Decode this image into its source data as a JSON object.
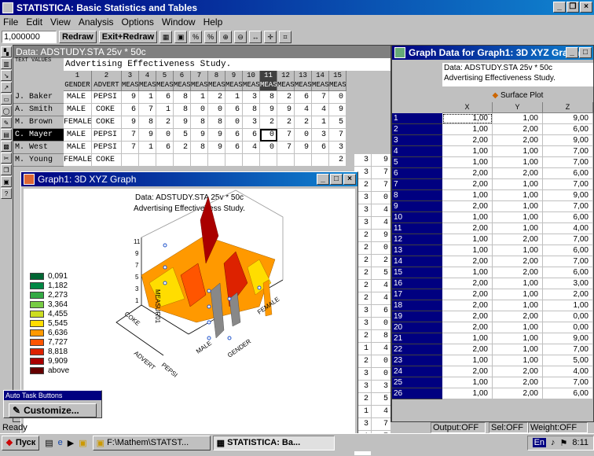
{
  "app": {
    "title": "STATISTICA: Basic Statistics and Tables"
  },
  "menu": [
    "File",
    "Edit",
    "View",
    "Analysis",
    "Options",
    "Window",
    "Help"
  ],
  "toolbar": {
    "cell_value": "1,000000",
    "redraw": "Redraw",
    "exit_redraw": "Exit+Redraw"
  },
  "data_window": {
    "title": "Data: ADSTUDY.STA 25v * 50c",
    "text_values_label": "TEXT VALUES",
    "text_values": "Advertising Effectiveness Study.",
    "col_numbers": [
      "1",
      "2",
      "3",
      "4",
      "5",
      "6",
      "7",
      "8",
      "9",
      "10",
      "11",
      "12",
      "13",
      "14",
      "15"
    ],
    "col_names": [
      "GENDER",
      "ADVERT",
      "MEAS",
      "MEAS",
      "MEAS",
      "MEAS",
      "MEAS",
      "MEAS",
      "MEAS",
      "MEAS",
      "MEAS",
      "MEAS",
      "MEAS",
      "MEAS",
      "MEAS"
    ],
    "rows": [
      {
        "label": "J. Baker",
        "cells": [
          "MALE",
          "PEPSI",
          "9",
          "1",
          "6",
          "8",
          "1",
          "2",
          "1",
          "3",
          "8",
          "2",
          "6",
          "7",
          "0"
        ]
      },
      {
        "label": "A. Smith",
        "cells": [
          "MALE",
          "COKE",
          "6",
          "7",
          "1",
          "8",
          "0",
          "0",
          "6",
          "8",
          "9",
          "9",
          "4",
          "4",
          "9"
        ]
      },
      {
        "label": "M. Brown",
        "cells": [
          "FEMALE",
          "COKE",
          "9",
          "8",
          "2",
          "9",
          "8",
          "8",
          "0",
          "3",
          "2",
          "2",
          "2",
          "1",
          "5"
        ]
      },
      {
        "label": "C. Mayer",
        "cells": [
          "MALE",
          "PEPSI",
          "7",
          "9",
          "0",
          "5",
          "9",
          "9",
          "6",
          "6",
          "0",
          "7",
          "0",
          "3",
          "7"
        ]
      },
      {
        "label": "M. West",
        "cells": [
          "MALE",
          "PEPSI",
          "7",
          "1",
          "6",
          "2",
          "8",
          "9",
          "6",
          "4",
          "0",
          "7",
          "9",
          "6",
          "3"
        ]
      },
      {
        "label": "M. Young",
        "cells": [
          "FEMALE",
          "COKE",
          "",
          "",
          "",
          "",
          "",
          "",
          "",
          "",
          "",
          "",
          "",
          "",
          "2"
        ]
      }
    ],
    "hidden_rows_right": [
      "9",
      "7",
      "7",
      "0",
      "4",
      "4",
      "9",
      "0",
      "2",
      "5",
      "4",
      "4",
      "6",
      "0",
      "8",
      "4",
      "0",
      "0",
      "3",
      "5",
      "4",
      "7",
      "7"
    ],
    "hidden_rows_mid": [
      "3",
      "3",
      "2",
      "3",
      "3",
      "3",
      "2",
      "2",
      "2",
      "2",
      "2",
      "2",
      "3",
      "3",
      "2",
      "1",
      "2",
      "3",
      "3",
      "2",
      "1",
      "3",
      "1",
      "4"
    ],
    "bottom_row": {
      "cells": [
        "PEPSI",
        "5",
        "1",
        "6",
        "9",
        "7",
        "7",
        "8",
        "6",
        "1",
        "0",
        "8",
        "9",
        "7"
      ]
    }
  },
  "graph_window": {
    "title": "Graph1: 3D XYZ Graph",
    "line1": "Data: ADSTUDY.STA 25v * 50c",
    "line2": "Advertising Effectiveness Study.",
    "zlabel": "MEASUR01",
    "ticks_z": [
      "11",
      "9",
      "7",
      "5",
      "3",
      "1"
    ],
    "axis_advert": "ADVERT",
    "axis_gender": "GENDER",
    "tick_coke": "COKE",
    "tick_pepsi": "PEPSI",
    "tick_male": "MALE",
    "tick_female": "FEMALE",
    "legend": [
      {
        "label": "0,091",
        "color": "#006633"
      },
      {
        "label": "1,182",
        "color": "#008844"
      },
      {
        "label": "2,273",
        "color": "#33aa44"
      },
      {
        "label": "3,364",
        "color": "#77cc44"
      },
      {
        "label": "4,455",
        "color": "#ccdd22"
      },
      {
        "label": "5,545",
        "color": "#ffdd00"
      },
      {
        "label": "6,636",
        "color": "#ff9900"
      },
      {
        "label": "7,727",
        "color": "#ff5500"
      },
      {
        "label": "8,818",
        "color": "#dd2200"
      },
      {
        "label": "9,909",
        "color": "#aa0000"
      },
      {
        "label": "above",
        "color": "#660000"
      }
    ]
  },
  "graph_data_window": {
    "title": "Graph Data for Graph1: 3D XYZ Graph",
    "line1": "Data: ADSTUDY.STA 25v * 50c",
    "line2": "Advertising Effectiveness Study.",
    "plot_label": "Surface Plot",
    "cols": [
      "X",
      "Y",
      "Z"
    ],
    "rows": [
      [
        "1",
        "1,00",
        "1,00",
        "9,00"
      ],
      [
        "2",
        "1,00",
        "2,00",
        "6,00"
      ],
      [
        "3",
        "2,00",
        "2,00",
        "9,00"
      ],
      [
        "4",
        "1,00",
        "1,00",
        "7,00"
      ],
      [
        "5",
        "1,00",
        "1,00",
        "7,00"
      ],
      [
        "6",
        "2,00",
        "2,00",
        "6,00"
      ],
      [
        "7",
        "2,00",
        "1,00",
        "7,00"
      ],
      [
        "8",
        "1,00",
        "1,00",
        "9,00"
      ],
      [
        "9",
        "2,00",
        "1,00",
        "7,00"
      ],
      [
        "10",
        "1,00",
        "1,00",
        "6,00"
      ],
      [
        "11",
        "2,00",
        "1,00",
        "4,00"
      ],
      [
        "12",
        "1,00",
        "2,00",
        "7,00"
      ],
      [
        "13",
        "1,00",
        "1,00",
        "6,00"
      ],
      [
        "14",
        "2,00",
        "2,00",
        "7,00"
      ],
      [
        "15",
        "1,00",
        "2,00",
        "6,00"
      ],
      [
        "16",
        "2,00",
        "1,00",
        "3,00"
      ],
      [
        "17",
        "2,00",
        "1,00",
        "2,00"
      ],
      [
        "18",
        "2,00",
        "1,00",
        "1,00"
      ],
      [
        "19",
        "2,00",
        "2,00",
        "0,00"
      ],
      [
        "20",
        "2,00",
        "1,00",
        "0,00"
      ],
      [
        "21",
        "1,00",
        "1,00",
        "9,00"
      ],
      [
        "22",
        "2,00",
        "1,00",
        "7,00"
      ],
      [
        "23",
        "1,00",
        "1,00",
        "5,00"
      ],
      [
        "24",
        "2,00",
        "2,00",
        "4,00"
      ],
      [
        "25",
        "1,00",
        "2,00",
        "7,00"
      ],
      [
        "26",
        "1,00",
        "2,00",
        "6,00"
      ]
    ]
  },
  "autotask": {
    "title": "Auto Task Buttons",
    "customize": "Customize..."
  },
  "status": {
    "left": "Ready",
    "output": "Output:OFF",
    "sel": "Sel:OFF",
    "weight": "Weight:OFF"
  },
  "taskbar": {
    "start": "Пуск",
    "item1": "F:\\Mathem\\STATST...",
    "item2": "STATISTICA: Ba...",
    "lang": "En",
    "time": "8:11"
  }
}
